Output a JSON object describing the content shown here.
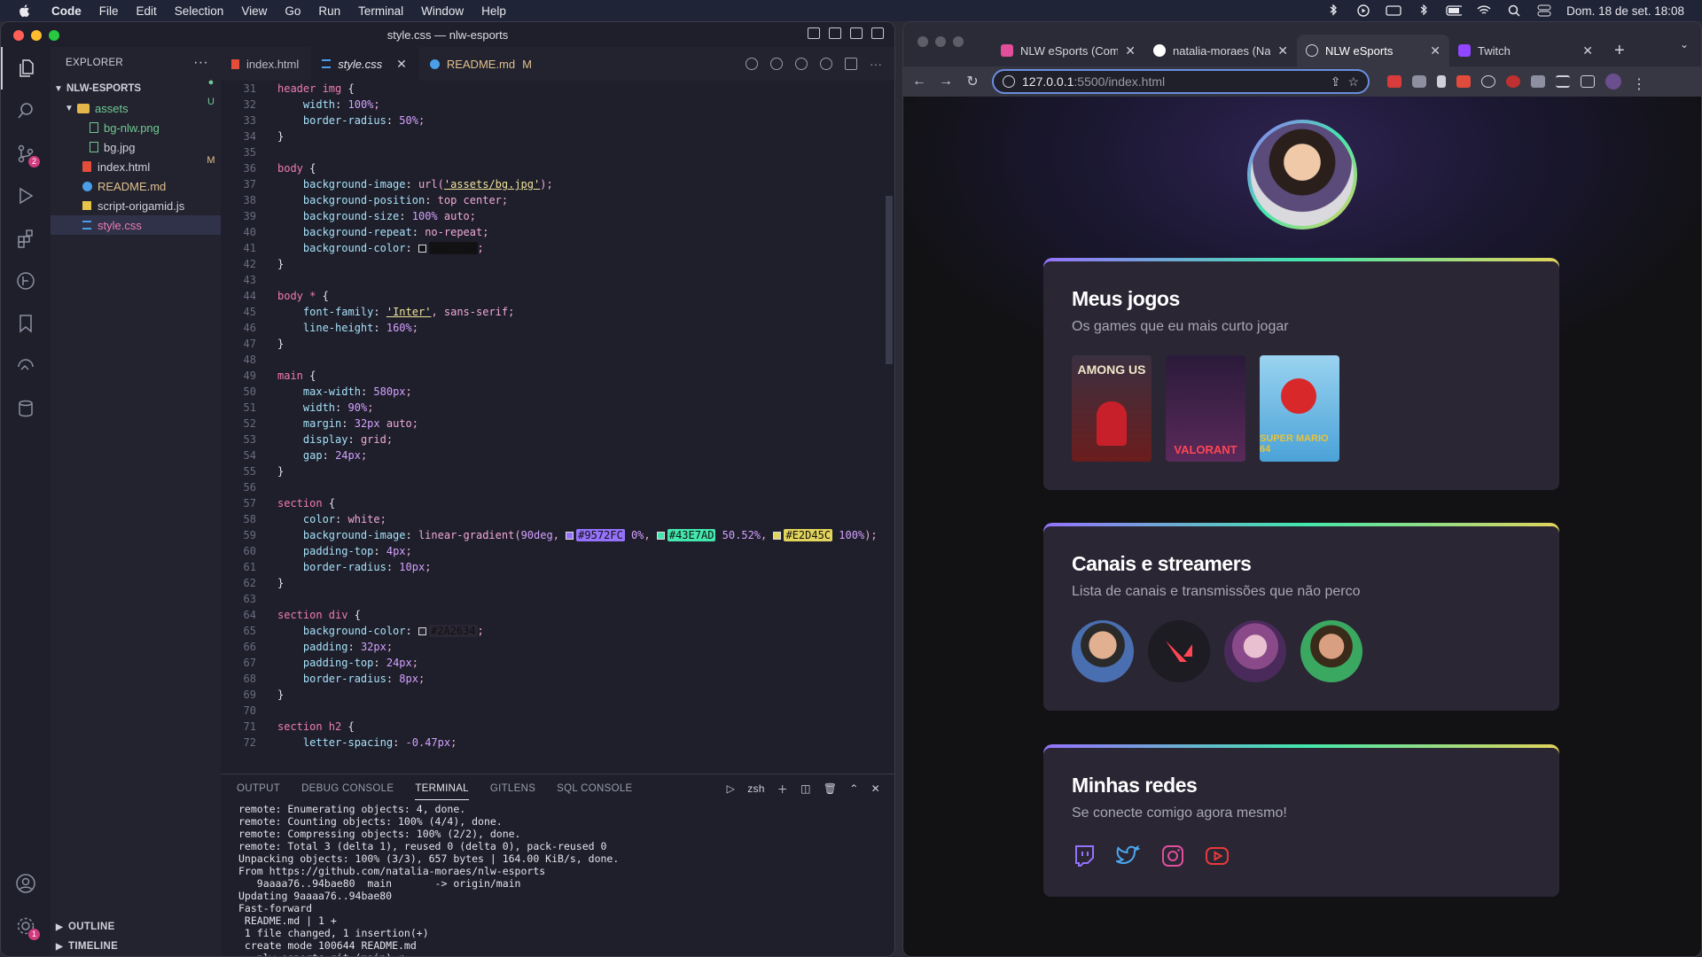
{
  "menubar": {
    "app": "Code",
    "items": [
      "File",
      "Edit",
      "Selection",
      "View",
      "Go",
      "Run",
      "Terminal",
      "Window",
      "Help"
    ],
    "clock": "Dom. 18 de set.  18:08"
  },
  "vscode": {
    "window_title": "style.css — nlw-esports",
    "explorer_title": "EXPLORER",
    "project": "NLW-ESPORTS",
    "tree": [
      {
        "name": "assets",
        "status": "●",
        "color": "#73c991"
      },
      {
        "name": "bg-nlw.png",
        "status": "U",
        "color": "#73c991"
      },
      {
        "name": "bg.jpg",
        "status": "",
        "color": "#cfd0da"
      },
      {
        "name": "index.html",
        "status": "",
        "color": "#cfd0da"
      },
      {
        "name": "README.md",
        "status": "M",
        "color": "#e2c08d"
      },
      {
        "name": "script-origamid.js",
        "status": "",
        "color": "#cfd0da"
      },
      {
        "name": "style.css",
        "status": "",
        "color": "#cfd0da"
      }
    ],
    "outline": "OUTLINE",
    "timeline": "TIMELINE",
    "tabs": [
      {
        "label": "index.html",
        "mod": ""
      },
      {
        "label": "style.css",
        "mod": ""
      },
      {
        "label": "README.md",
        "mod": "M"
      }
    ],
    "scm_badge": "2",
    "settings_badge": "1",
    "code_lines": [
      {
        "n": "31",
        "t": "header img {"
      },
      {
        "n": "32",
        "t": "    width: 100%;"
      },
      {
        "n": "33",
        "t": "    border-radius: 50%;"
      },
      {
        "n": "34",
        "t": "}"
      },
      {
        "n": "35",
        "t": ""
      },
      {
        "n": "36",
        "t": "body {"
      },
      {
        "n": "37",
        "t": "    background-image: url('assets/bg.jpg');"
      },
      {
        "n": "38",
        "t": "    background-position: top center;"
      },
      {
        "n": "39",
        "t": "    background-size: 100% auto;"
      },
      {
        "n": "40",
        "t": "    background-repeat: no-repeat;"
      },
      {
        "n": "41",
        "t": "    background-color: #121214;"
      },
      {
        "n": "42",
        "t": "}"
      },
      {
        "n": "43",
        "t": ""
      },
      {
        "n": "44",
        "t": "body * {"
      },
      {
        "n": "45",
        "t": "    font-family: 'Inter', sans-serif;"
      },
      {
        "n": "46",
        "t": "    line-height: 160%;"
      },
      {
        "n": "47",
        "t": "}"
      },
      {
        "n": "48",
        "t": ""
      },
      {
        "n": "49",
        "t": "main {"
      },
      {
        "n": "50",
        "t": "    max-width: 580px;"
      },
      {
        "n": "51",
        "t": "    width: 90%;"
      },
      {
        "n": "52",
        "t": "    margin: 32px auto;"
      },
      {
        "n": "53",
        "t": "    display: grid;"
      },
      {
        "n": "54",
        "t": "    gap: 24px;"
      },
      {
        "n": "55",
        "t": "}"
      },
      {
        "n": "56",
        "t": ""
      },
      {
        "n": "57",
        "t": "section {"
      },
      {
        "n": "58",
        "t": "    color: white;"
      },
      {
        "n": "59",
        "t": "    background-image: linear-gradient(90deg, #9572FC 0%, #43E7AD 50.52%, #E2D45C 100%);"
      },
      {
        "n": "60",
        "t": "    padding-top: 4px;"
      },
      {
        "n": "61",
        "t": "    border-radius: 10px;"
      },
      {
        "n": "62",
        "t": "}"
      },
      {
        "n": "63",
        "t": ""
      },
      {
        "n": "64",
        "t": "section div {"
      },
      {
        "n": "65",
        "t": "    background-color: #2A2634;"
      },
      {
        "n": "66",
        "t": "    padding: 32px;"
      },
      {
        "n": "67",
        "t": "    padding-top: 24px;"
      },
      {
        "n": "68",
        "t": "    border-radius: 8px;"
      },
      {
        "n": "69",
        "t": "}"
      },
      {
        "n": "70",
        "t": ""
      },
      {
        "n": "71",
        "t": "section h2 {"
      },
      {
        "n": "72",
        "t": "    letter-spacing: -0.47px;"
      }
    ],
    "panel_tabs": [
      "OUTPUT",
      "DEBUG CONSOLE",
      "TERMINAL",
      "GITLENS",
      "SQL CONSOLE"
    ],
    "shell": "zsh",
    "terminal": [
      "remote: Enumerating objects: 4, done.",
      "remote: Counting objects: 100% (4/4), done.",
      "remote: Compressing objects: 100% (2/2), done.",
      "remote: Total 3 (delta 1), reused 0 (delta 0), pack-reused 0",
      "Unpacking objects: 100% (3/3), 657 bytes | 164.00 KiB/s, done.",
      "From https://github.com/natalia-moraes/nlw-esports",
      "   9aaaa76..94bae80  main       -> origin/main",
      "Updating 9aaaa76..94bae80",
      "Fast-forward",
      " README.md | 1 +",
      " 1 file changed, 1 insertion(+)",
      " create mode 100644 README.md",
      "➜  nlw-esports git:(main) ✗ "
    ]
  },
  "browser": {
    "tabs": [
      {
        "label": "NLW eSports (Com",
        "fav": "#e04e9c"
      },
      {
        "label": "natalia-moraes (Na",
        "fav": "#ffffff"
      },
      {
        "label": "NLW eSports",
        "fav": "#cfd0da"
      },
      {
        "label": "Twitch",
        "fav": "#9146ff"
      }
    ],
    "url_host": "127.0.0.1",
    "url_path": ":5500/index.html"
  },
  "site": {
    "sections": [
      {
        "title": "Meus jogos",
        "subtitle": "Os games que eu mais curto jogar"
      },
      {
        "title": "Canais e streamers",
        "subtitle": "Lista de canais e transmissões que não perco"
      },
      {
        "title": "Minhas redes",
        "subtitle": "Se conecte comigo agora mesmo!"
      }
    ],
    "games": [
      {
        "label": "AMONG US",
        "bg": "#6b1d1d"
      },
      {
        "label": "VALORANT",
        "bg": "#3a2447"
      },
      {
        "label": "SUPER MARIO 64",
        "bg": "#63b8e0"
      }
    ],
    "gradient_colors": [
      "#9572FC",
      "#43E7AD",
      "#E2D45C"
    ],
    "socials": [
      "twitch-icon",
      "twitter-icon",
      "instagram-icon",
      "youtube-icon"
    ]
  }
}
